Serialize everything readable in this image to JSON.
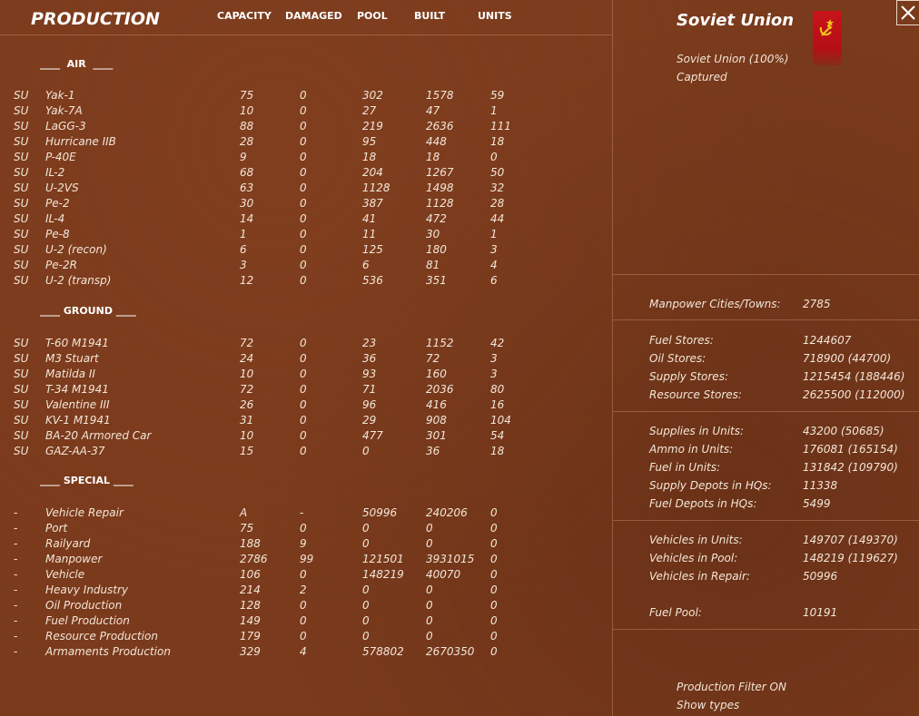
{
  "header": {
    "title": "PRODUCTION",
    "columns": [
      "CAPACITY",
      "DAMAGED",
      "POOL",
      "BUILT",
      "UNITS"
    ]
  },
  "sections": [
    {
      "label": "____  AIR  ____",
      "rows": [
        [
          "SU",
          "Yak-1",
          "75",
          "0",
          "302",
          "1578",
          "59"
        ],
        [
          "SU",
          "Yak-7A",
          "10",
          "0",
          "27",
          "47",
          "1"
        ],
        [
          "SU",
          "LaGG-3",
          "88",
          "0",
          "219",
          "2636",
          "111"
        ],
        [
          "SU",
          "Hurricane IIB",
          "28",
          "0",
          "95",
          "448",
          "18"
        ],
        [
          "SU",
          "P-40E",
          "9",
          "0",
          "18",
          "18",
          "0"
        ],
        [
          "SU",
          "IL-2",
          "68",
          "0",
          "204",
          "1267",
          "50"
        ],
        [
          "SU",
          "U-2VS",
          "63",
          "0",
          "1128",
          "1498",
          "32"
        ],
        [
          "SU",
          "Pe-2",
          "30",
          "0",
          "387",
          "1128",
          "28"
        ],
        [
          "SU",
          "IL-4",
          "14",
          "0",
          "41",
          "472",
          "44"
        ],
        [
          "SU",
          "Pe-8",
          "1",
          "0",
          "11",
          "30",
          "1"
        ],
        [
          "SU",
          "U-2 (recon)",
          "6",
          "0",
          "125",
          "180",
          "3"
        ],
        [
          "SU",
          "Pe-2R",
          "3",
          "0",
          "6",
          "81",
          "4"
        ],
        [
          "SU",
          "U-2 (transp)",
          "12",
          "0",
          "536",
          "351",
          "6"
        ]
      ]
    },
    {
      "label": "____ GROUND ____",
      "rows": [
        [
          "SU",
          "T-60 M1941",
          "72",
          "0",
          "23",
          "1152",
          "42"
        ],
        [
          "SU",
          "M3 Stuart",
          "24",
          "0",
          "36",
          "72",
          "3"
        ],
        [
          "SU",
          "Matilda II",
          "10",
          "0",
          "93",
          "160",
          "3"
        ],
        [
          "SU",
          "T-34 M1941",
          "72",
          "0",
          "71",
          "2036",
          "80"
        ],
        [
          "SU",
          "Valentine III",
          "26",
          "0",
          "96",
          "416",
          "16"
        ],
        [
          "SU",
          "KV-1 M1941",
          "31",
          "0",
          "29",
          "908",
          "104"
        ],
        [
          "SU",
          "BA-20 Armored Car",
          "10",
          "0",
          "477",
          "301",
          "54"
        ],
        [
          "SU",
          "GAZ-AA-37",
          "15",
          "0",
          "0",
          "36",
          "18"
        ]
      ]
    },
    {
      "label": "____ SPECIAL ____",
      "rows": [
        [
          "-",
          "Vehicle Repair",
          "A",
          "-",
          "50996",
          "240206",
          "0"
        ],
        [
          "-",
          "Port",
          "75",
          "0",
          "0",
          "0",
          "0"
        ],
        [
          "-",
          "Railyard",
          "188",
          "9",
          "0",
          "0",
          "0"
        ],
        [
          "-",
          "Manpower",
          "2786",
          "99",
          "121501",
          "3931015",
          "0"
        ],
        [
          "-",
          "Vehicle",
          "106",
          "0",
          "148219",
          "40070",
          "0"
        ],
        [
          "-",
          "Heavy Industry",
          "214",
          "2",
          "0",
          "0",
          "0"
        ],
        [
          "-",
          "Oil Production",
          "128",
          "0",
          "0",
          "0",
          "0"
        ],
        [
          "-",
          "Fuel Production",
          "149",
          "0",
          "0",
          "0",
          "0"
        ],
        [
          "-",
          "Resource Production",
          "179",
          "0",
          "0",
          "0",
          "0"
        ],
        [
          "-",
          "Armaments Production",
          "329",
          "4",
          "578802",
          "2670350",
          "0"
        ]
      ]
    }
  ],
  "nation": {
    "name": "Soviet Union",
    "line1": "Soviet Union  (100%)",
    "line2": "Captured",
    "flag_color": "#c8141a"
  },
  "stats": [
    {
      "label": "Manpower Cities/Towns:",
      "value": "2785"
    },
    {
      "label": "Fuel Stores:",
      "value": "1244607"
    },
    {
      "label": "Oil Stores:",
      "value": "718900 (44700)"
    },
    {
      "label": "Supply Stores:",
      "value": "1215454 (188446)"
    },
    {
      "label": "Resource Stores:",
      "value": "2625500 (112000)"
    },
    {
      "label": "Supplies in Units:",
      "value": "43200 (50685)"
    },
    {
      "label": "Ammo in Units:",
      "value": "176081 (165154)"
    },
    {
      "label": "Fuel in Units:",
      "value": "131842 (109790)"
    },
    {
      "label": "Supply Depots in HQs:",
      "value": "11338"
    },
    {
      "label": "Fuel Depots in HQs:",
      "value": "5499"
    },
    {
      "label": "Vehicles in Units:",
      "value": "149707 (149370)"
    },
    {
      "label": "Vehicles in Pool:",
      "value": "148219 (119627)"
    },
    {
      "label": "Vehicles in Repair:",
      "value": "50996"
    },
    {
      "label": "Fuel Pool:",
      "value": "10191"
    }
  ],
  "footer": {
    "filter": "Production Filter ON",
    "types": "Show types"
  }
}
